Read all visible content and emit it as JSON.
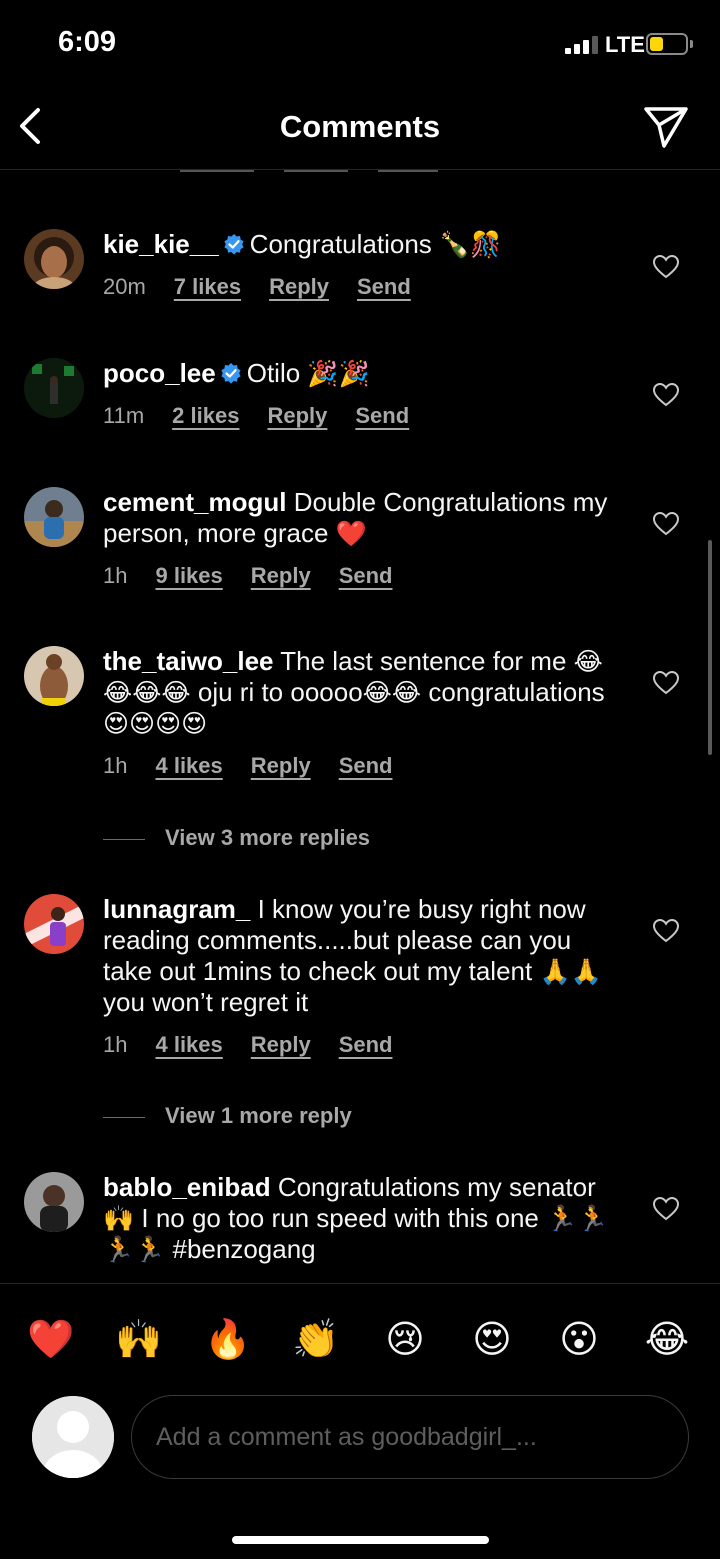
{
  "status_bar": {
    "time": "6:09",
    "network": "LTE",
    "battery_color": "#ffd60a"
  },
  "header": {
    "title": "Comments"
  },
  "comments": [
    {
      "username": "kie_kie__",
      "verified": true,
      "text": "Congratulations",
      "emojis": "🍾🎊",
      "time": "20m",
      "likes": "7 likes",
      "reply": "Reply",
      "send": "Send"
    },
    {
      "username": "poco_lee",
      "verified": true,
      "text": "Otilo",
      "emojis": "🎉🎉",
      "time": "11m",
      "likes": "2 likes",
      "reply": "Reply",
      "send": "Send"
    },
    {
      "username": "cement_mogul",
      "verified": false,
      "text": "Double Congratulations my person, more grace",
      "emojis": "❤️",
      "time": "1h",
      "likes": "9 likes",
      "reply": "Reply",
      "send": "Send"
    },
    {
      "username": "the_taiwo_lee",
      "verified": false,
      "text_1": "The last sentence for me",
      "emojis_1": "😂😂😂😂",
      "text_2": "oju ri to ooooo",
      "emojis_2": "😂😂",
      "text_3": "congratulations",
      "emojis_3": "😍😍😍😍",
      "time": "1h",
      "likes": "4 likes",
      "reply": "Reply",
      "send": "Send",
      "view_more": "View 3 more replies"
    },
    {
      "username": "lunnagram_",
      "verified": false,
      "text_1": "I know you’re busy right now reading comments.....but please can you take out 1mins to check out my talent",
      "emojis_1": "🙏🙏",
      "text_2": "you won’t regret it",
      "time": "1h",
      "likes": "4 likes",
      "reply": "Reply",
      "send": "Send",
      "view_more": "View 1 more reply"
    },
    {
      "username": "bablo_enibad",
      "verified": false,
      "text_1": "Congratulations my senator",
      "emojis_1": "🙌",
      "text_2": "I no go too run speed with this one",
      "emojis_2": "🏃🏃🏃🏃",
      "text_3": "#benzogang"
    }
  ],
  "quick_emojis": [
    "❤️",
    "🙌",
    "🔥",
    "👏",
    "😢",
    "😍",
    "😮",
    "😂"
  ],
  "composer": {
    "placeholder": "Add a comment as goodbadgirl_..."
  },
  "colors": {
    "background": "#000000",
    "verified_badge": "#3797f0",
    "secondary_text": "#a8a8a8"
  }
}
